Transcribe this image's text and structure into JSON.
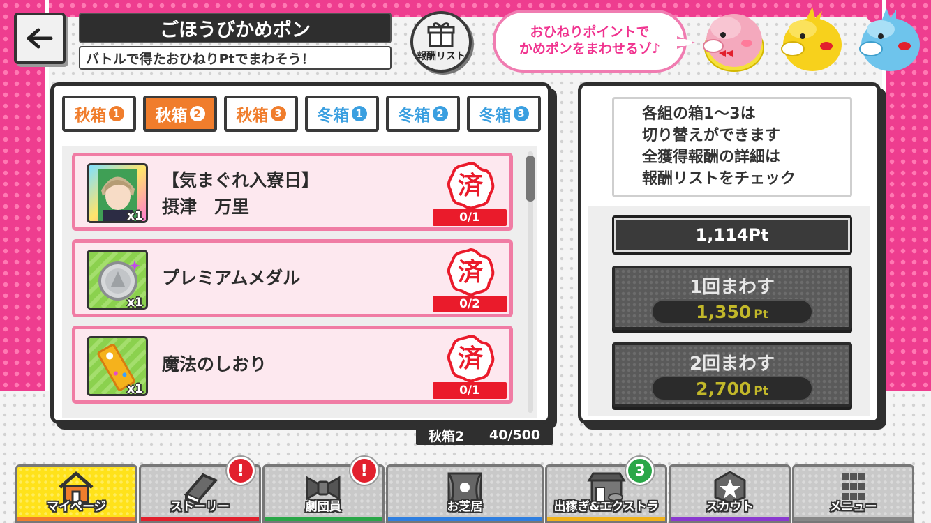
{
  "header": {
    "back_icon": "arrow-left-icon",
    "title": "ごほうびかめポン",
    "subtitle": "バトルで得たおひねりPtでまわそう！",
    "reward_list_label": "報酬リスト",
    "bubble_line1": "おひねりポイントで",
    "bubble_line2": "かめポンをまわせるゾ♪"
  },
  "tabs": [
    {
      "label": "秋箱",
      "num": "1",
      "kind": "autumn",
      "active": false
    },
    {
      "label": "秋箱",
      "num": "2",
      "kind": "autumn",
      "active": true
    },
    {
      "label": "秋箱",
      "num": "3",
      "kind": "autumn",
      "active": false
    },
    {
      "label": "冬箱",
      "num": "1",
      "kind": "winter",
      "active": false
    },
    {
      "label": "冬箱",
      "num": "2",
      "kind": "winter",
      "active": false
    },
    {
      "label": "冬箱",
      "num": "3",
      "kind": "winter",
      "active": false
    }
  ],
  "rewards": [
    {
      "name_line1": "【気まぐれ入寮日】",
      "name_line2": "摂津　万里",
      "qty": "x1",
      "stamp": "済",
      "count": "0/1",
      "icon": "character-card-icon"
    },
    {
      "name_line1": "プレミアムメダル",
      "name_line2": "",
      "qty": "x1",
      "stamp": "済",
      "count": "0/2",
      "icon": "premium-medal-icon"
    },
    {
      "name_line1": "魔法のしおり",
      "name_line2": "",
      "qty": "x1",
      "stamp": "済",
      "count": "0/1",
      "icon": "bookmark-icon"
    }
  ],
  "progress": {
    "box": "秋箱2",
    "count": "40/500"
  },
  "info": {
    "line1": "各組の箱1～3は",
    "line2": "切り替えができます",
    "line3": "全獲得報酬の詳細は",
    "line4": "報酬リストをチェック"
  },
  "points": "1,114Pt",
  "spin1": {
    "label": "1回まわす",
    "cost": "1,350",
    "unit": "Pt"
  },
  "spin2": {
    "label": "2回まわす",
    "cost": "2,700",
    "unit": "Pt"
  },
  "nav": [
    {
      "label": "マイページ",
      "icon": "home-icon",
      "active": true,
      "color": "#f07d2c"
    },
    {
      "label": "ストーリー",
      "icon": "book-icon",
      "alert": "!",
      "color": "#e2202d"
    },
    {
      "label": "劇団員",
      "icon": "bowtie-icon",
      "alert": "!",
      "color": "#2aa748"
    },
    {
      "label": "お芝居",
      "icon": "stage-icon",
      "color": "#2f7fe0"
    },
    {
      "label": "出稼ぎ&エクストラ",
      "icon": "shop-icon",
      "count": "3",
      "color": "#f0b21a"
    },
    {
      "label": "スカウト",
      "icon": "star-badge-icon",
      "color": "#8a3ad0"
    },
    {
      "label": "メニュー",
      "icon": "grid-menu-icon",
      "color": "#888888"
    }
  ],
  "colors": {
    "accent_pink": "#ee3d8f",
    "autumn": "#f07d2c",
    "winter": "#3a9fe0",
    "stamp_red": "#ea1b2b"
  }
}
